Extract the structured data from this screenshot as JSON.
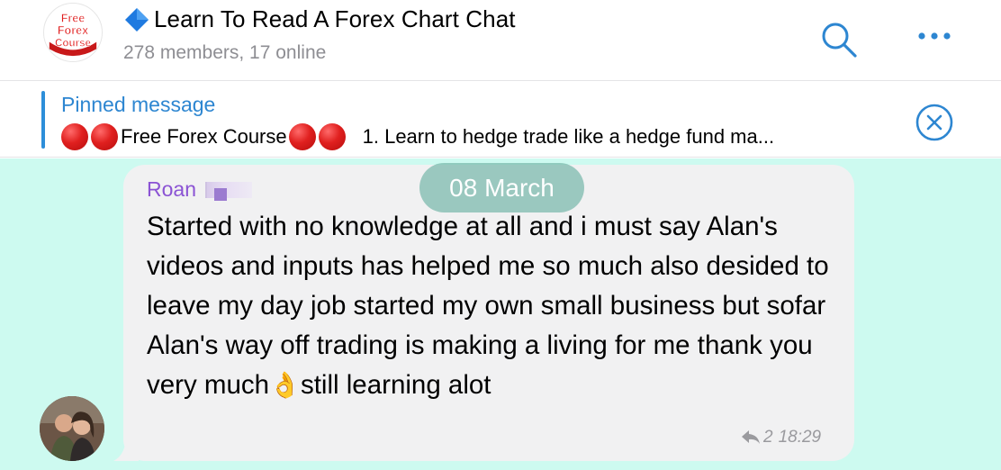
{
  "header": {
    "logo_text": [
      "Free",
      "Forex",
      "Course"
    ],
    "title": "Learn To Read A Forex Chart Chat",
    "title_icon": "blue-diamond-icon",
    "subtitle": "278 members, 17 online",
    "actions": [
      "search-icon",
      "more-icon"
    ]
  },
  "pinned": {
    "title": "Pinned message",
    "segment_1": "Free Forex Course",
    "segment_2": "1. Learn to hedge trade like a hedge fund ma...",
    "close_icon": "close-circle-icon"
  },
  "chat": {
    "date_label": "08 March",
    "message": {
      "sender": "Roan",
      "text_part_1": "Started with no knowledge at all and i must say Alan's videos and inputs has helped me so much also desided to leave my day job started my own small business but sofar Alan's way off trading is making a living for me thank you very much",
      "emoji": "👌",
      "text_part_2": "still learning alot",
      "forward_icon": "forward-arrow-icon",
      "forward_count": "2",
      "time": "18:29"
    }
  },
  "colors": {
    "accent": "#2d86d1",
    "sender_color": "#8b53d4",
    "chat_background": "#cdfaf0",
    "bubble": "#f1f1f2",
    "pin_red": "#e0201f"
  }
}
